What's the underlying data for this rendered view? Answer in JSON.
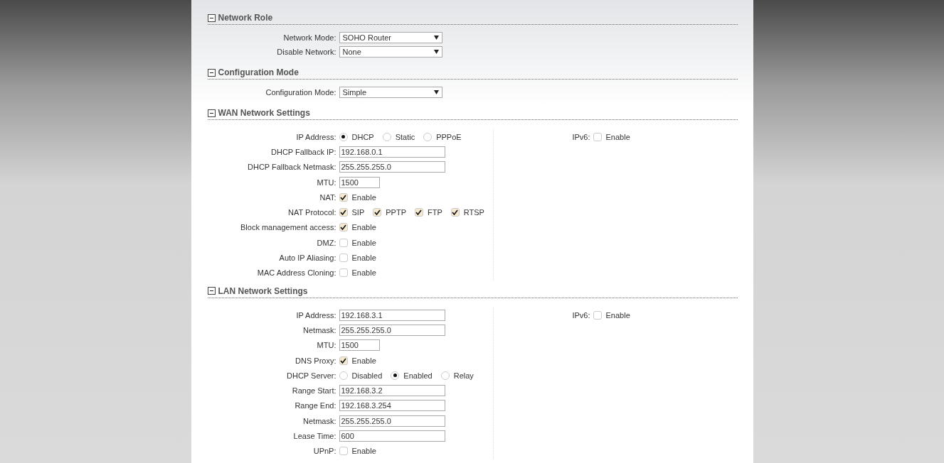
{
  "sections": [
    {
      "title": "Network Role",
      "expanded": true,
      "left": [
        {
          "kind": "select",
          "label": "Network Mode:",
          "value": "SOHO Router"
        },
        {
          "kind": "select",
          "label": "Disable Network:",
          "value": "None"
        }
      ]
    },
    {
      "title": "Configuration Mode",
      "expanded": true,
      "left": [
        {
          "kind": "select",
          "label": "Configuration Mode:",
          "value": "Simple"
        }
      ]
    },
    {
      "title": "WAN Network Settings",
      "expanded": true,
      "left": [
        {
          "kind": "radio",
          "label": "IP Address:",
          "options": [
            {
              "label": "DHCP",
              "selected": true
            },
            {
              "label": "Static",
              "selected": false
            },
            {
              "label": "PPPoE",
              "selected": false
            }
          ]
        },
        {
          "kind": "text",
          "label": "DHCP Fallback IP:",
          "value": "192.168.0.1"
        },
        {
          "kind": "text",
          "label": "DHCP Fallback Netmask:",
          "value": "255.255.255.0"
        },
        {
          "kind": "short",
          "label": "MTU:",
          "value": "1500"
        },
        {
          "kind": "check",
          "label": "NAT:",
          "options": [
            {
              "label": "Enable",
              "checked": true
            }
          ]
        },
        {
          "kind": "check",
          "label": "NAT Protocol:",
          "options": [
            {
              "label": "SIP",
              "checked": true
            },
            {
              "label": "PPTP",
              "checked": true
            },
            {
              "label": "FTP",
              "checked": true
            },
            {
              "label": "RTSP",
              "checked": true
            }
          ]
        },
        {
          "kind": "check",
          "label": "Block management access:",
          "options": [
            {
              "label": "Enable",
              "checked": true
            }
          ]
        },
        {
          "kind": "check",
          "label": "DMZ:",
          "options": [
            {
              "label": "Enable",
              "checked": false
            }
          ]
        },
        {
          "kind": "check",
          "label": "Auto IP Aliasing:",
          "options": [
            {
              "label": "Enable",
              "checked": false
            }
          ]
        },
        {
          "kind": "check",
          "label": "MAC Address Cloning:",
          "options": [
            {
              "label": "Enable",
              "checked": false
            }
          ]
        }
      ],
      "right": [
        {
          "kind": "check",
          "label": "IPv6:",
          "options": [
            {
              "label": "Enable",
              "checked": false
            }
          ]
        }
      ]
    },
    {
      "title": "LAN Network Settings",
      "expanded": true,
      "left": [
        {
          "kind": "text",
          "label": "IP Address:",
          "value": "192.168.3.1"
        },
        {
          "kind": "text",
          "label": "Netmask:",
          "value": "255.255.255.0"
        },
        {
          "kind": "short",
          "label": "MTU:",
          "value": "1500"
        },
        {
          "kind": "check",
          "label": "DNS Proxy:",
          "options": [
            {
              "label": "Enable",
              "checked": true
            }
          ]
        },
        {
          "kind": "radio",
          "label": "DHCP Server:",
          "options": [
            {
              "label": "Disabled",
              "selected": false
            },
            {
              "label": "Enabled",
              "selected": true
            },
            {
              "label": "Relay",
              "selected": false
            }
          ]
        },
        {
          "kind": "text",
          "label": "Range Start:",
          "value": "192.168.3.2"
        },
        {
          "kind": "text",
          "label": "Range End:",
          "value": "192.168.3.254"
        },
        {
          "kind": "text",
          "label": "Netmask:",
          "value": "255.255.255.0"
        },
        {
          "kind": "text",
          "label": "Lease Time:",
          "value": "600"
        },
        {
          "kind": "check",
          "label": "UPnP:",
          "options": [
            {
              "label": "Enable",
              "checked": false
            }
          ]
        }
      ],
      "right": [
        {
          "kind": "check",
          "label": "IPv6:",
          "options": [
            {
              "label": "Enable",
              "checked": false
            }
          ]
        }
      ]
    }
  ]
}
